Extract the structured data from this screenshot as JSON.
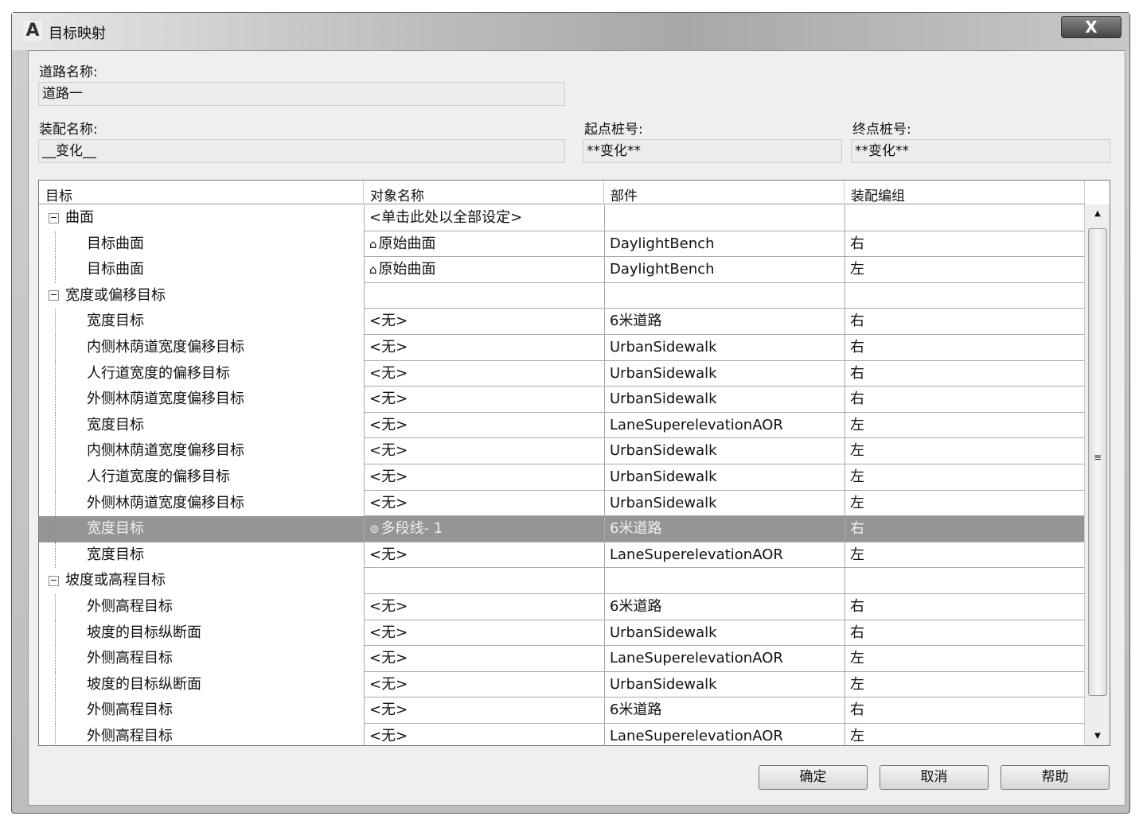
{
  "window": {
    "title": "目标映射",
    "close": "X"
  },
  "road_name": {
    "label": "道路名称:",
    "value": "道路一"
  },
  "assembly_name": {
    "label": "装配名称:",
    "value": "__变化__"
  },
  "start_station": {
    "label": "起点桩号:",
    "value": "**变化**"
  },
  "end_station": {
    "label": "终点桩号:",
    "value": "**变化**"
  },
  "table": {
    "columns": [
      "目标",
      "对象名称",
      "部件",
      "装配编组"
    ],
    "rows": [
      {
        "target": "曲面",
        "object": "<单击此处以全部设定>",
        "part": "",
        "group": "",
        "group_row": true
      },
      {
        "target": "目标曲面",
        "object": "原始曲面",
        "part": "DaylightBench",
        "group": "右",
        "icon": "surface"
      },
      {
        "target": "目标曲面",
        "object": "原始曲面",
        "part": "DaylightBench",
        "group": "左",
        "icon": "surface"
      },
      {
        "target": "宽度或偏移目标",
        "object": "",
        "part": "",
        "group": "",
        "group_row": true
      },
      {
        "target": "宽度目标",
        "object": "<无>",
        "part": "6米道路",
        "group": "右"
      },
      {
        "target": "内侧林荫道宽度偏移目标",
        "object": "<无>",
        "part": "UrbanSidewalk",
        "group": "右"
      },
      {
        "target": "人行道宽度的偏移目标",
        "object": "<无>",
        "part": "UrbanSidewalk",
        "group": "右"
      },
      {
        "target": "外侧林荫道宽度偏移目标",
        "object": "<无>",
        "part": "UrbanSidewalk",
        "group": "右"
      },
      {
        "target": "宽度目标",
        "object": "<无>",
        "part": "LaneSuperelevationAOR",
        "group": "左"
      },
      {
        "target": "内侧林荫道宽度偏移目标",
        "object": "<无>",
        "part": "UrbanSidewalk",
        "group": "左"
      },
      {
        "target": "人行道宽度的偏移目标",
        "object": "<无>",
        "part": "UrbanSidewalk",
        "group": "左"
      },
      {
        "target": "外侧林荫道宽度偏移目标",
        "object": "<无>",
        "part": "UrbanSidewalk",
        "group": "左"
      },
      {
        "target": "宽度目标",
        "object": "多段线- 1",
        "part": "6米道路",
        "group": "右",
        "icon": "polyline",
        "selected": true
      },
      {
        "target": "宽度目标",
        "object": "<无>",
        "part": "LaneSuperelevationAOR",
        "group": "左"
      },
      {
        "target": "坡度或高程目标",
        "object": "",
        "part": "",
        "group": "",
        "group_row": true
      },
      {
        "target": "外侧高程目标",
        "object": "<无>",
        "part": "6米道路",
        "group": "右"
      },
      {
        "target": "坡度的目标纵断面",
        "object": "<无>",
        "part": "UrbanSidewalk",
        "group": "右"
      },
      {
        "target": "外侧高程目标",
        "object": "<无>",
        "part": "LaneSuperelevationAOR",
        "group": "左"
      },
      {
        "target": "坡度的目标纵断面",
        "object": "<无>",
        "part": "UrbanSidewalk",
        "group": "左"
      },
      {
        "target": "外侧高程目标",
        "object": "<无>",
        "part": "6米道路",
        "group": "右"
      },
      {
        "target": "外侧高程目标",
        "object": "<无>",
        "part": "LaneSuperelevationAOR",
        "group": "左"
      }
    ]
  },
  "buttons": {
    "ok": "确定",
    "cancel": "取消",
    "help": "帮助"
  }
}
